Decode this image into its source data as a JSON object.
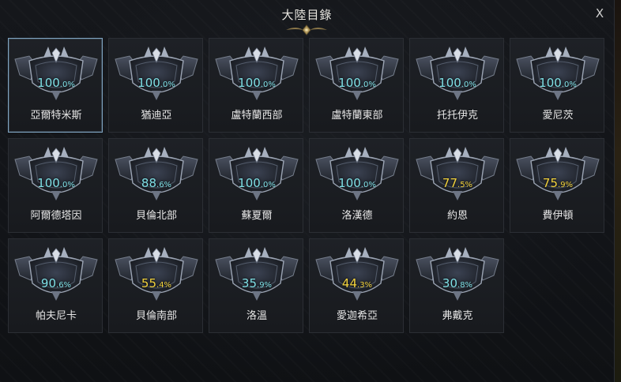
{
  "window": {
    "title": "大陸目錄",
    "close_label": "X"
  },
  "colors": {
    "complete": "#7fe0e6",
    "incomplete": "#f2d23c",
    "selected_border": "#7fa3c0"
  },
  "regions": [
    {
      "name": "亞爾特米斯",
      "pct_int": "100",
      "pct_dec": ".0%",
      "status": "complete",
      "selected": true
    },
    {
      "name": "猶迪亞",
      "pct_int": "100",
      "pct_dec": ".0%",
      "status": "complete",
      "selected": false
    },
    {
      "name": "盧特蘭西部",
      "pct_int": "100",
      "pct_dec": ".0%",
      "status": "complete",
      "selected": false
    },
    {
      "name": "盧特蘭東部",
      "pct_int": "100",
      "pct_dec": ".0%",
      "status": "complete",
      "selected": false
    },
    {
      "name": "托托伊克",
      "pct_int": "100",
      "pct_dec": ".0%",
      "status": "complete",
      "selected": false
    },
    {
      "name": "愛尼茨",
      "pct_int": "100",
      "pct_dec": ".0%",
      "status": "complete",
      "selected": false
    },
    {
      "name": "阿爾德塔因",
      "pct_int": "100",
      "pct_dec": ".0%",
      "status": "complete",
      "selected": false
    },
    {
      "name": "貝倫北部",
      "pct_int": "88",
      "pct_dec": ".6%",
      "status": "complete",
      "selected": false
    },
    {
      "name": "蘇夏爾",
      "pct_int": "100",
      "pct_dec": ".0%",
      "status": "complete",
      "selected": false
    },
    {
      "name": "洛漢德",
      "pct_int": "100",
      "pct_dec": ".0%",
      "status": "complete",
      "selected": false
    },
    {
      "name": "約恩",
      "pct_int": "77",
      "pct_dec": ".5%",
      "status": "incomplete",
      "selected": false
    },
    {
      "name": "費伊頓",
      "pct_int": "75",
      "pct_dec": ".9%",
      "status": "incomplete",
      "selected": false
    },
    {
      "name": "帕夫尼卡",
      "pct_int": "90",
      "pct_dec": ".6%",
      "status": "complete",
      "selected": false
    },
    {
      "name": "貝倫南部",
      "pct_int": "55",
      "pct_dec": ".4%",
      "status": "incomplete",
      "selected": false
    },
    {
      "name": "洛溫",
      "pct_int": "35",
      "pct_dec": ".9%",
      "status": "complete",
      "selected": false
    },
    {
      "name": "愛迦希亞",
      "pct_int": "44",
      "pct_dec": ".3%",
      "status": "incomplete",
      "selected": false
    },
    {
      "name": "弗戴克",
      "pct_int": "30",
      "pct_dec": ".8%",
      "status": "complete",
      "selected": false
    }
  ]
}
